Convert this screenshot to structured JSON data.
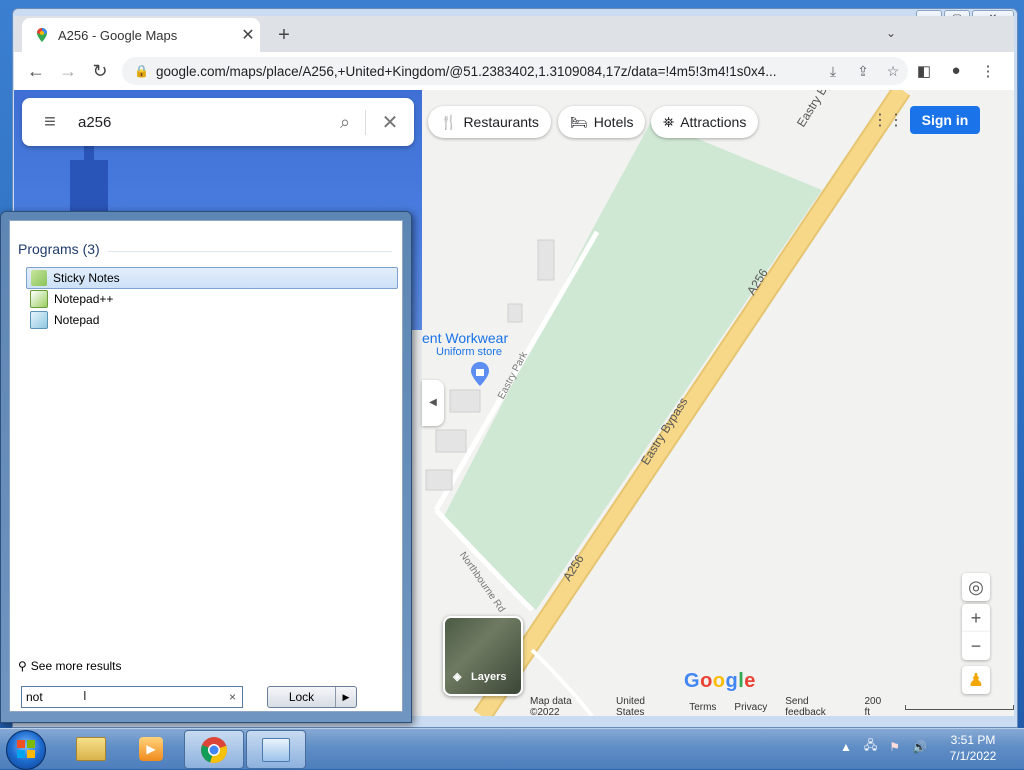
{
  "browser": {
    "tab_title": "A256 - Google Maps",
    "tab_close": "✕",
    "new_tab": "+",
    "url": "google.com/maps/place/A256,+United+Kingdom/@51.2383402,1.3109084,17z/data=!4m5!3m4!1s0x4..."
  },
  "maps": {
    "search_value": "a256",
    "chips": [
      {
        "label": "Restaurants",
        "icon": "🍴"
      },
      {
        "label": "Hotels",
        "icon": "🛏"
      },
      {
        "label": "Attractions",
        "icon": "⛯"
      }
    ],
    "signin_label": "Sign in",
    "poi": {
      "name": "ent Workwear",
      "type": "Uniform store"
    },
    "road_labels": {
      "eastry_bypass_1": "Eastry Bypass",
      "eastry_bypass_2": "Eastry Bypass",
      "a256_1": "A256",
      "a256_2": "A256",
      "eastry_park": "Eastry Park",
      "northbourne": "Northbourne Rd"
    },
    "layers_label": "Layers",
    "google_logo": "Google",
    "footer": {
      "map_data": "Map data ©2022",
      "region": "United States",
      "terms": "Terms",
      "privacy": "Privacy",
      "feedback": "Send feedback",
      "scale": "200 ft"
    },
    "zoom_in": "+",
    "zoom_out": "−",
    "colors": {
      "park": "#cfe8d4",
      "road": "#f7d889",
      "accent": "#1a73e8"
    }
  },
  "start_menu": {
    "section_title": "Programs (3)",
    "programs": [
      {
        "label": "Sticky Notes",
        "selected": true
      },
      {
        "label": "Notepad++",
        "selected": false
      },
      {
        "label": "Notepad",
        "selected": false
      }
    ],
    "see_more": "See more results",
    "search_value": "not",
    "clear": "×",
    "lock_label": "Lock",
    "lock_arrow": "▶"
  },
  "taskbar": {
    "time": "3:51 PM",
    "date": "7/1/2022"
  }
}
